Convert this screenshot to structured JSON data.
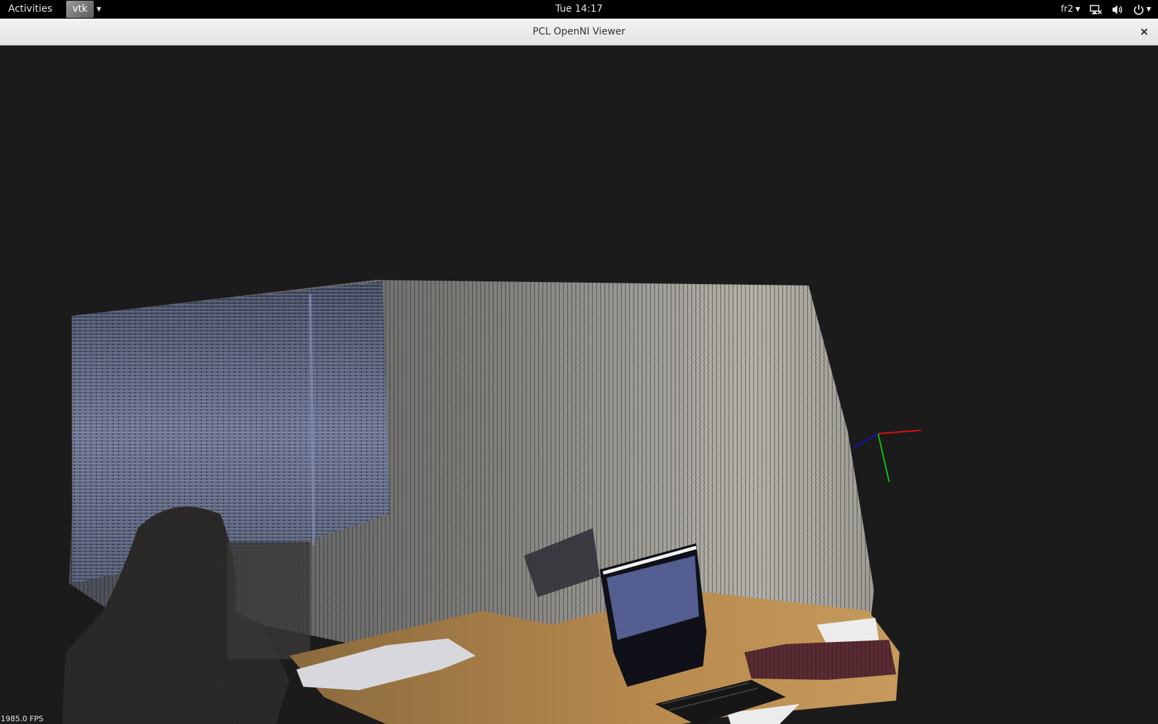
{
  "topbar": {
    "activities_label": "Activities",
    "app_menu_label": "vtk",
    "clock": "Tue 14:17",
    "keyboard_layout": "fr2"
  },
  "window": {
    "title": "PCL OpenNI Viewer"
  },
  "viewer": {
    "fps_label": "1985.0 FPS",
    "axes_colors": {
      "x": "#e01010",
      "y": "#10c010",
      "z": "#1010c0"
    }
  },
  "icons": [
    "network-icon",
    "volume-icon",
    "power-icon",
    "close-icon"
  ]
}
